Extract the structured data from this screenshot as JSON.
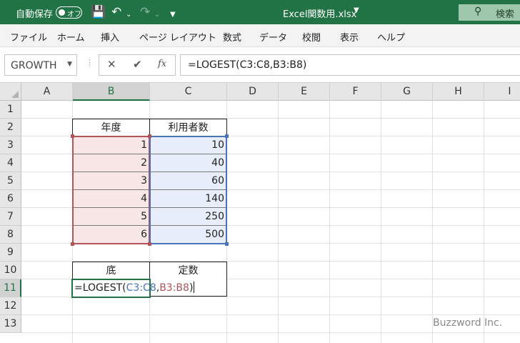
{
  "titlebar": {
    "autosave_label": "自動保存",
    "autosave_state": "オフ",
    "filename": "Excel関数用.xlsx",
    "search_label": "検索"
  },
  "ribbon": {
    "tabs": [
      "ファイル",
      "ホーム",
      "挿入",
      "ページ レイアウト",
      "数式",
      "データ",
      "校閲",
      "表示",
      "ヘルプ"
    ]
  },
  "formula_bar": {
    "name_box": "GROWTH",
    "formula": "=LOGEST(C3:C8,B3:B8)",
    "fx_label": "fx"
  },
  "grid": {
    "columns": [
      "A",
      "B",
      "C",
      "D",
      "E",
      "F",
      "G",
      "H",
      "I"
    ],
    "rows": [
      "1",
      "2",
      "3",
      "4",
      "5",
      "6",
      "7",
      "8",
      "9",
      "10",
      "11",
      "12",
      "13"
    ]
  },
  "table1": {
    "headers": [
      "年度",
      "利用者数"
    ],
    "rows": [
      [
        "1",
        "10"
      ],
      [
        "2",
        "40"
      ],
      [
        "3",
        "60"
      ],
      [
        "4",
        "140"
      ],
      [
        "5",
        "250"
      ],
      [
        "6",
        "500"
      ]
    ]
  },
  "table2": {
    "headers": [
      "底",
      "定数"
    ]
  },
  "editing_cell": {
    "prefix": "=LOGEST(",
    "ref1": "C3:C8",
    "comma": ",",
    "ref2": "B3:B8",
    "suffix": ")"
  },
  "watermark": "Buzzword Inc.",
  "colors": {
    "excel_green": "#217346",
    "ref_blue": "#4a74b8",
    "ref_red": "#b3535a"
  }
}
